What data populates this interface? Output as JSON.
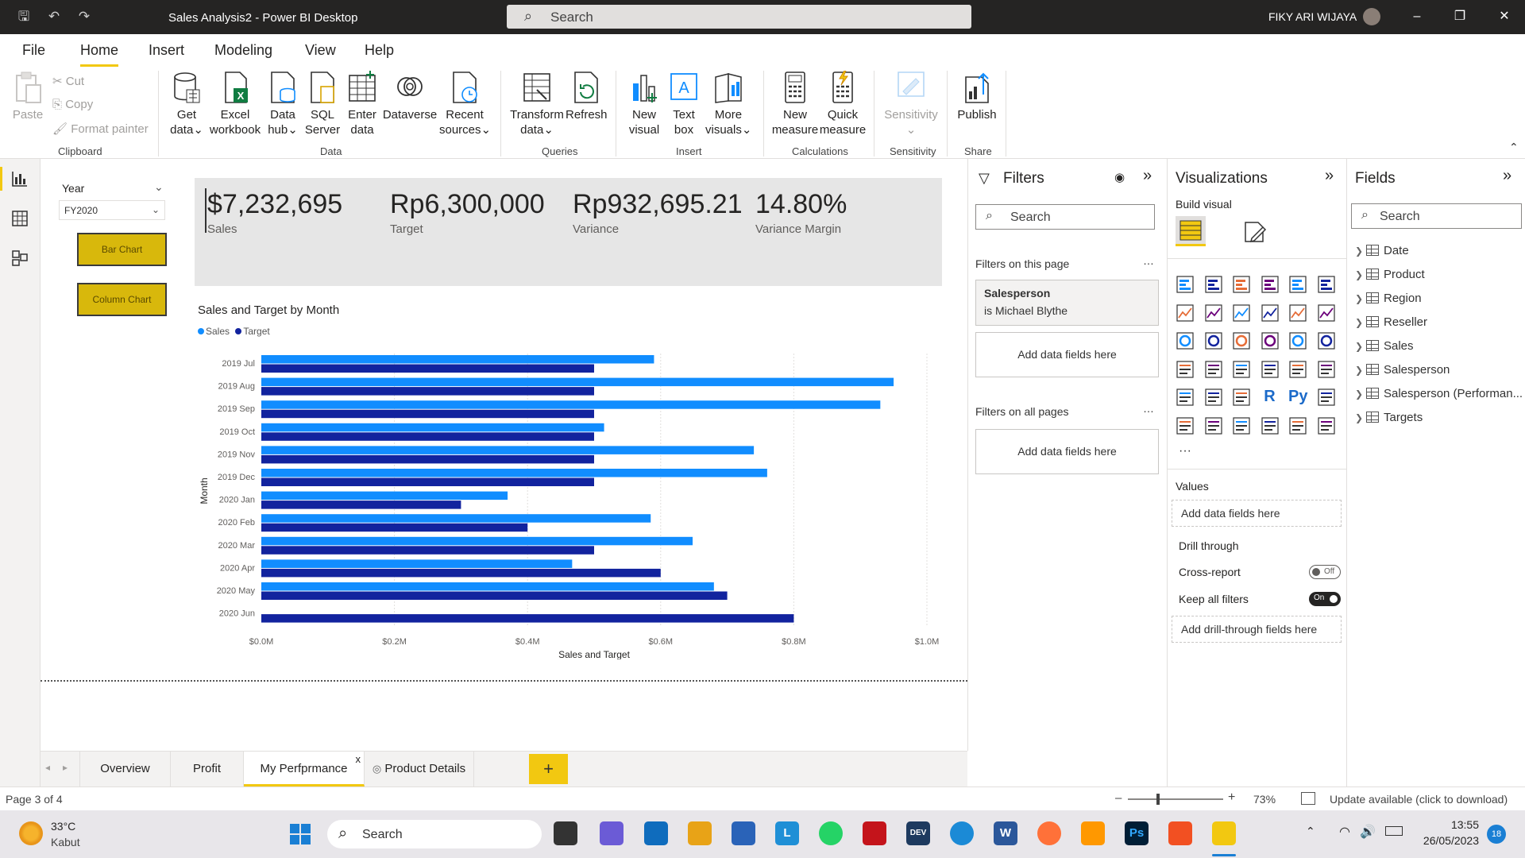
{
  "window": {
    "title": "Sales Analysis2 - Power BI Desktop",
    "search_placeholder": "Search",
    "user": "FIKY ARI WIJAYA"
  },
  "menu": {
    "tabs": [
      "File",
      "Home",
      "Insert",
      "Modeling",
      "View",
      "Help"
    ],
    "active": "Home"
  },
  "ribbon": {
    "clipboard": {
      "paste": "Paste",
      "cut": "Cut",
      "copy": "Copy",
      "format_painter": "Format painter",
      "group": "Clipboard"
    },
    "data": {
      "get_data": [
        "Get",
        "data"
      ],
      "excel": [
        "Excel",
        "workbook"
      ],
      "data_hub": [
        "Data",
        "hub"
      ],
      "sql": [
        "SQL",
        "Server"
      ],
      "enter": [
        "Enter",
        "data"
      ],
      "dataverse": "Dataverse",
      "recent": [
        "Recent",
        "sources"
      ],
      "group": "Data"
    },
    "queries": {
      "transform": [
        "Transform",
        "data"
      ],
      "refresh": "Refresh",
      "group": "Queries"
    },
    "insert": {
      "new_visual": [
        "New",
        "visual"
      ],
      "text_box": [
        "Text",
        "box"
      ],
      "more_visuals": [
        "More",
        "visuals"
      ],
      "group": "Insert"
    },
    "calculations": {
      "new_measure": [
        "New",
        "measure"
      ],
      "quick_measure": [
        "Quick",
        "measure"
      ],
      "group": "Calculations"
    },
    "sensitivity": {
      "label": "Sensitivity",
      "group": "Sensitivity"
    },
    "share": {
      "publish": "Publish",
      "group": "Share"
    }
  },
  "report": {
    "slicer": {
      "label": "Year",
      "value": "FY2020"
    },
    "buttons": {
      "bar": "Bar Chart",
      "column": "Column Chart"
    },
    "kpis": [
      {
        "value": "$7,232,695",
        "label": "Sales"
      },
      {
        "value": "Rp6,300,000",
        "label": "Target"
      },
      {
        "value": "Rp932,695.21",
        "label": "Variance"
      },
      {
        "value": "14.80%",
        "label": "Variance Margin"
      }
    ]
  },
  "chart_data": {
    "type": "bar",
    "orientation": "horizontal",
    "title": "Sales and Target by Month",
    "xlabel": "Sales and Target",
    "ylabel": "Month",
    "categories": [
      "2019 Jul",
      "2019 Aug",
      "2019 Sep",
      "2019 Oct",
      "2019 Nov",
      "2019 Dec",
      "2020 Jan",
      "2020 Feb",
      "2020 Mar",
      "2020 Apr",
      "2020 May",
      "2020 Jun"
    ],
    "series": [
      {
        "name": "Sales",
        "color": "#118dff",
        "values": [
          0.59,
          0.95,
          0.93,
          0.515,
          0.74,
          0.76,
          0.37,
          0.585,
          0.648,
          0.467,
          0.68,
          0
        ]
      },
      {
        "name": "Target",
        "color": "#12239e",
        "values": [
          0.5,
          0.5,
          0.5,
          0.5,
          0.5,
          0.5,
          0.3,
          0.4,
          0.5,
          0.6,
          0.7,
          0.8
        ]
      }
    ],
    "xlim": [
      0,
      1.0
    ],
    "xticks": [
      "$0.0M",
      "$0.2M",
      "$0.4M",
      "$0.6M",
      "$0.8M",
      "$1.0M"
    ],
    "grid": true,
    "legend": "top-left"
  },
  "page_tabs": {
    "tabs": [
      "Overview",
      "Profit",
      "My Perfprmance",
      "Product Details"
    ],
    "active": "My Perfprmance",
    "close": "x",
    "add": "+"
  },
  "filters": {
    "title": "Filters",
    "search": "Search",
    "on_this_page": "Filters on this page",
    "card_title": "Salesperson",
    "card_value": "is Michael Blythe",
    "add_fields": "Add data fields here",
    "on_all_pages": "Filters on all pages",
    "more": "…"
  },
  "visualizations": {
    "title": "Visualizations",
    "build": "Build visual",
    "r_label": "R",
    "py_label": "Py",
    "more": "···",
    "values": "Values",
    "add_fields": "Add data fields here",
    "drill_through": "Drill through",
    "cross_report": "Cross-report",
    "cross_state": "Off",
    "keep_filters": "Keep all filters",
    "keep_state": "On",
    "add_drill": "Add drill-through fields here"
  },
  "fields": {
    "title": "Fields",
    "search": "Search",
    "tables": [
      "Date",
      "Product",
      "Region",
      "Reseller",
      "Sales",
      "Salesperson",
      "Salesperson (Performan...",
      "Targets"
    ]
  },
  "status": {
    "page": "Page 3 of 4",
    "zoom": "73%",
    "update": "Update available (click to download)"
  },
  "taskbar": {
    "weather_temp": "33°C",
    "weather_desc": "Kabut",
    "search": "Search",
    "time": "13:55",
    "date": "26/05/2023",
    "notif": "18"
  }
}
